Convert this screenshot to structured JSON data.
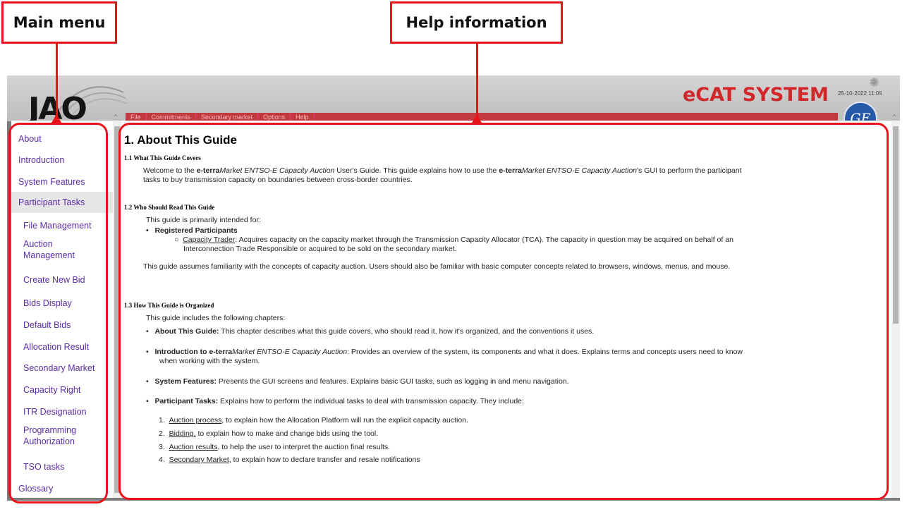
{
  "annotations": {
    "main_menu": "Main menu",
    "help_information": "Help information"
  },
  "header": {
    "logo": "JAO",
    "system_title": "eCAT SYSTEM",
    "datetime": "25-10-2022 11:05",
    "ge_logo": "GE",
    "menu": [
      "File",
      "Commitments",
      "Secondary market",
      "Options",
      "Help"
    ]
  },
  "nav": {
    "items": [
      {
        "label": "About"
      },
      {
        "label": "Introduction"
      },
      {
        "label": "System Features"
      },
      {
        "label": "Participant Tasks"
      },
      {
        "label": "File Management"
      },
      {
        "label": "Auction Management"
      },
      {
        "label": "Create New Bid"
      },
      {
        "label": "Bids Display"
      },
      {
        "label": "Default Bids"
      },
      {
        "label": "Allocation Result"
      },
      {
        "label": "Secondary Market"
      },
      {
        "label": "Capacity Right"
      },
      {
        "label": "ITR Designation"
      },
      {
        "label": "Programming Authorization"
      },
      {
        "label": "TSO tasks"
      },
      {
        "label": "Glossary"
      }
    ]
  },
  "help": {
    "title": "1. About This Guide",
    "s1": {
      "heading": "1.1 What This Guide Covers",
      "p1": "Welcome to the ",
      "p1_b1": "e-terra",
      "p1_i1": "Market ENTSO-E Capacity Auction",
      "p1_2": " User's Guide. This guide explains how to use the ",
      "p1_b2": "e-terra",
      "p1_i2": "Market ENTSO-E Capacity Auction",
      "p1_3": "'s GUI to perform the participant",
      "p1_line2": "tasks to buy transmission capacity on boundaries between cross-border countries."
    },
    "s2": {
      "heading": "1.2 Who Should Read This Guide",
      "intro": "This guide is primarily intended for:",
      "bullet": "Registered Participants",
      "sub_link": "Capacity Trader",
      "sub_text": ": Acquires capacity on the capacity market through the Transmission Capacity Allocator (TCA). The capacity in question may be acquired on behalf of an",
      "sub_line2": "Interconnection Trade Responsible or acquired to be sold on the secondary market.",
      "assume": "This guide assumes familiarity with the concepts of capacity auction. Users should also be familiar with basic computer concepts related to browsers, windows, menus, and mouse."
    },
    "s3": {
      "heading": "1.3 How This Guide is Organized",
      "intro": "This guide includes the following chapters:",
      "c1_b": "About This Guide:",
      "c1_t": " This chapter describes what this guide covers, who should read it, how it's organized, and the conventions it uses.",
      "c2_b": "Introduction to e-terra",
      "c2_bi": "Market ENTSO-E Capacity Auction",
      "c2_t": ": Provides an overview of the system, its components and what it does. Explains terms and concepts users need to know",
      "c2_line2": "when working with the system.",
      "c3_b": "System Features:",
      "c3_t": " Presents the GUI screens and features. Explains basic GUI tasks, such as logging in and menu navigation.",
      "c4_b": "Participant Tasks:",
      "c4_t": " Explains how to perform the individual tasks to deal with transmission capacity. They include:",
      "list": [
        {
          "num": "1.",
          "link": "Auction process",
          "text": ", to explain how the Allocation Platform will run the explicit capacity auction."
        },
        {
          "num": "2.",
          "link": "Bidding,",
          "text": " to explain how to make and change bids using the tool."
        },
        {
          "num": "3.",
          "link": "Auction results",
          "text": ", to help the user to interpret the auction final results."
        },
        {
          "num": "4.",
          "link": "Secondary Market",
          "text": ", to explain how to declare transfer and resale notifications"
        }
      ]
    }
  }
}
